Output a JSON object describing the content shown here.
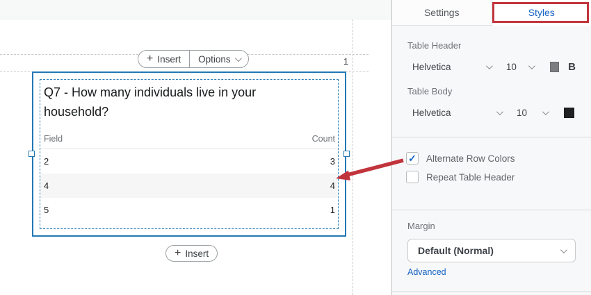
{
  "canvas": {
    "page_number": "1",
    "toolbar": {
      "insert_label": "Insert",
      "options_label": "Options"
    },
    "bottom_toolbar": {
      "insert_label": "Insert"
    },
    "widget": {
      "title": "Q7 - How many individuals live in your household?",
      "table": {
        "columns": [
          "Field",
          "Count"
        ],
        "rows": [
          {
            "field": "2",
            "count": "3"
          },
          {
            "field": "4",
            "count": "4"
          },
          {
            "field": "5",
            "count": "1"
          }
        ]
      }
    }
  },
  "sidebar": {
    "tabs": [
      {
        "label": "Settings",
        "active": false
      },
      {
        "label": "Styles",
        "active": true
      }
    ],
    "table_header": {
      "label": "Table Header",
      "font": "Helvetica",
      "size": "10",
      "color": "#7b7e81",
      "bold_label": "B"
    },
    "table_body": {
      "label": "Table Body",
      "font": "Helvetica",
      "size": "10",
      "color": "#1f2122"
    },
    "checkboxes": [
      {
        "label": "Alternate Row Colors",
        "checked": true,
        "check_glyph": "✓"
      },
      {
        "label": "Repeat Table Header",
        "checked": false
      }
    ],
    "margin": {
      "label": "Margin",
      "value": "Default (Normal)"
    },
    "advanced_link": "Advanced"
  },
  "colors": {
    "selection_blue": "#2278b5",
    "active_tab_blue": "#1261c4",
    "annotation_red": "#c1343c",
    "alternate_row_gray": "#f6f6f6"
  }
}
